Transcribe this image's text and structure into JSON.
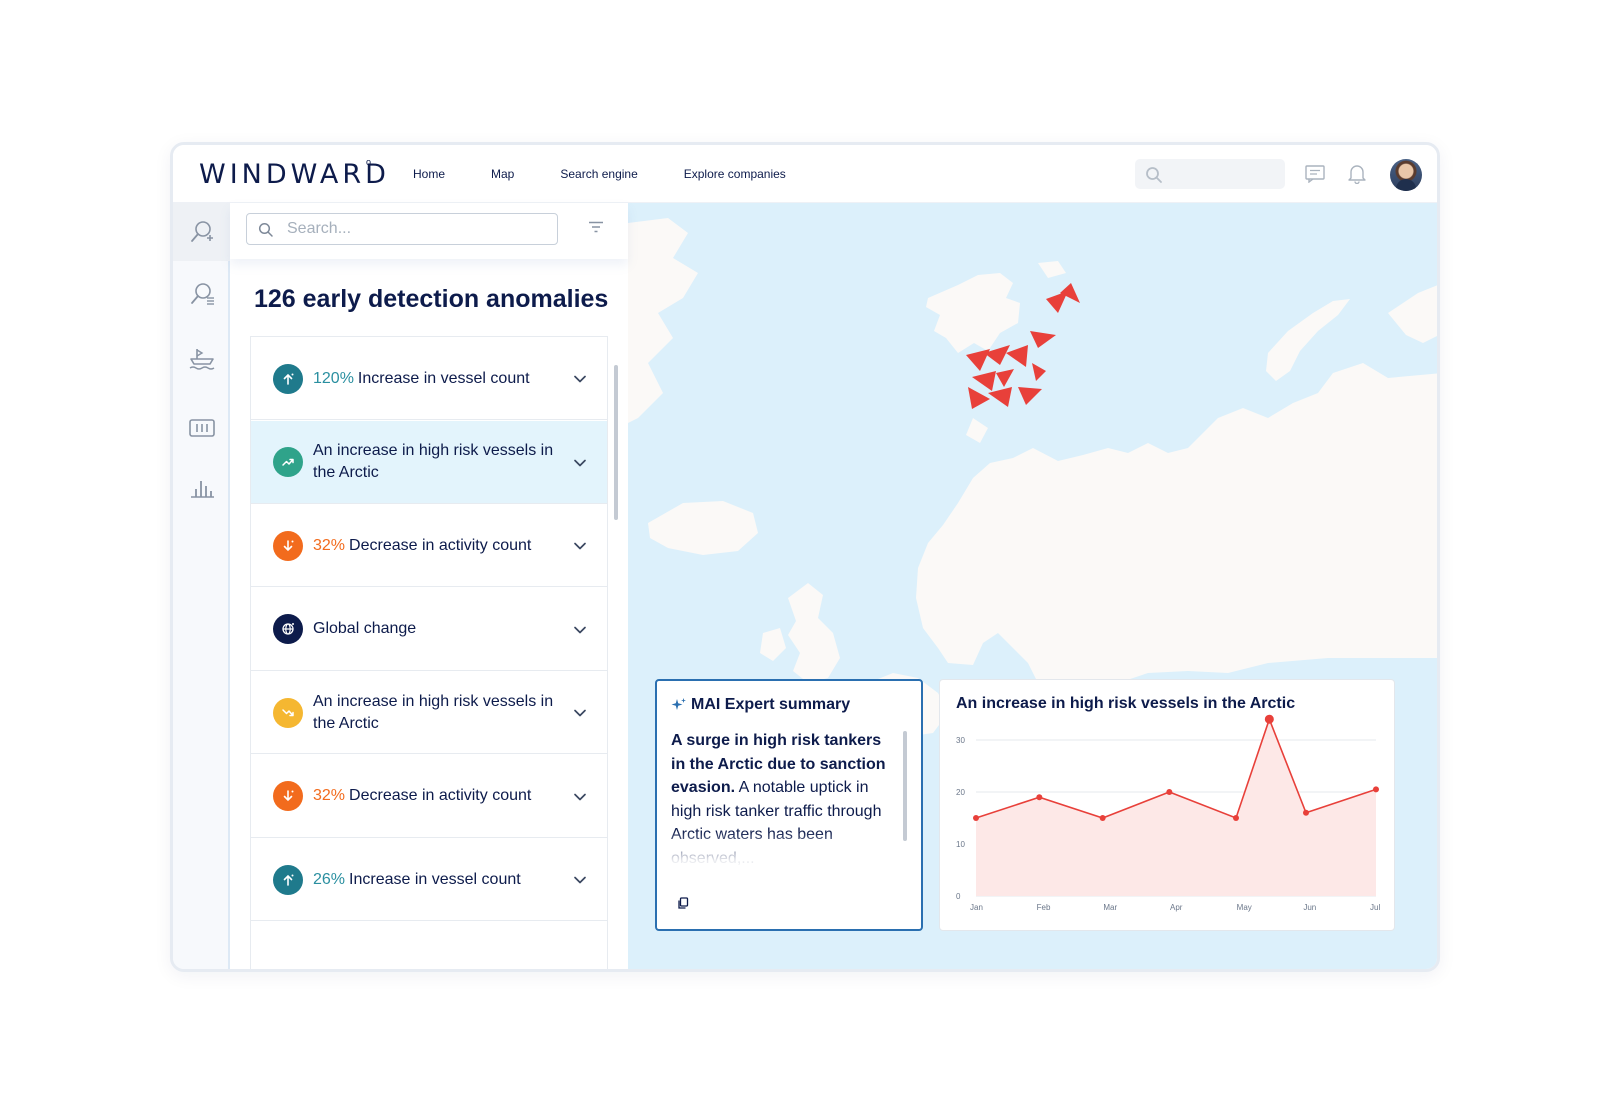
{
  "brand": {
    "logo": "WINDWARD",
    "mark": "o"
  },
  "nav": {
    "items": [
      "Home",
      "Map",
      "Search engine",
      "Explore companies"
    ]
  },
  "panel": {
    "search_placeholder": "Search...",
    "title": "126 early detection anomalies",
    "anomalies": [
      {
        "pct": "120%",
        "text": "Increase in vessel count",
        "icon": "arrow-up-icon",
        "color": "#1f7a8c",
        "pct_color": "#2a8fa0"
      },
      {
        "pct": "",
        "text": "An increase in high risk vessels in the Arctic",
        "icon": "trend-up-icon",
        "color": "#2fa38a",
        "pct_color": "",
        "selected": true
      },
      {
        "pct": "32%",
        "text": "Decrease in activity count",
        "icon": "arrow-down-icon",
        "color": "#f26b1d",
        "pct_color": "#f26b1d"
      },
      {
        "pct": "",
        "text": "Global change",
        "icon": "globe-icon",
        "color": "#0d1b4b",
        "pct_color": ""
      },
      {
        "pct": "",
        "text": "An increase in high risk vessels in the Arctic",
        "icon": "trend-down-icon",
        "color": "#f5b731",
        "pct_color": ""
      },
      {
        "pct": "32%",
        "text": "Decrease in activity count",
        "icon": "arrow-down-icon",
        "color": "#f26b1d",
        "pct_color": "#f26b1d"
      },
      {
        "pct": "26%",
        "text": "Increase in vessel count",
        "icon": "arrow-up-icon",
        "color": "#1f7a8c",
        "pct_color": "#2a8fa0"
      }
    ]
  },
  "summary": {
    "title": "MAI Expert summary",
    "bold": "A surge in high risk tankers in the Arctic due to sanction evasion.",
    "text": " A notable uptick in high risk tanker traffic through Arctic waters has been observed,..."
  },
  "chart_data": {
    "type": "line",
    "title": "An increase in high risk vessels in the Arctic",
    "categories": [
      "Jan",
      "Feb",
      "Mar",
      "Apr",
      "May",
      "Jun",
      "Jul"
    ],
    "x": [
      0,
      0.95,
      1.9,
      2.9,
      3.9,
      4.4,
      4.95,
      6.0
    ],
    "values": [
      15,
      19,
      15,
      20,
      15,
      34,
      16,
      20.5
    ],
    "yticks": [
      0,
      10,
      20,
      30
    ],
    "ylim": [
      0,
      30
    ],
    "color": "#e8403a",
    "fill": "#fde8e7",
    "grid": true
  },
  "colors": {
    "map_water": "#dcf0fb",
    "map_land": "#fbf9f7",
    "vessel": "#e8403a",
    "accent": "#2a6fb0"
  }
}
